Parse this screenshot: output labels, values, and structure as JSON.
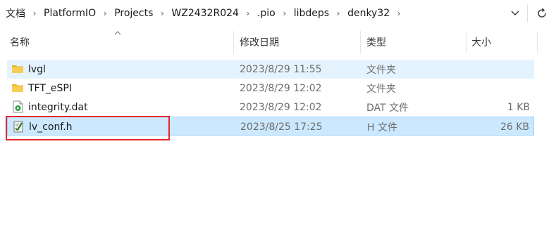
{
  "breadcrumb": [
    "文档",
    "PlatformIO",
    "Projects",
    "WZ2432R024",
    ".pio",
    "libdeps",
    "denky32"
  ],
  "breadcrumb_separator": "›",
  "toolbar": {
    "dropdown_icon": "chevron-down-icon",
    "refresh_icon": "refresh-icon"
  },
  "columns": {
    "name": "名称",
    "date": "修改日期",
    "type": "类型",
    "size": "大小"
  },
  "files": [
    {
      "name": "lvgl",
      "date": "2023/8/29 11:55",
      "type": "文件夹",
      "size": "",
      "icon": "folder-icon"
    },
    {
      "name": "TFT_eSPI",
      "date": "2023/8/29 12:02",
      "type": "文件夹",
      "size": "",
      "icon": "folder-icon"
    },
    {
      "name": "integrity.dat",
      "date": "2023/8/29 12:02",
      "type": "DAT 文件",
      "size": "1 KB",
      "icon": "dat-file-icon"
    },
    {
      "name": "lv_conf.h",
      "date": "2023/8/25 17:25",
      "type": "H 文件",
      "size": "26 KB",
      "icon": "header-file-icon"
    }
  ],
  "colors": {
    "selected_row": "#cce8ff",
    "hover_row": "#e5f3ff",
    "highlight_box": "#e0282e",
    "folder": "#f5c242"
  }
}
